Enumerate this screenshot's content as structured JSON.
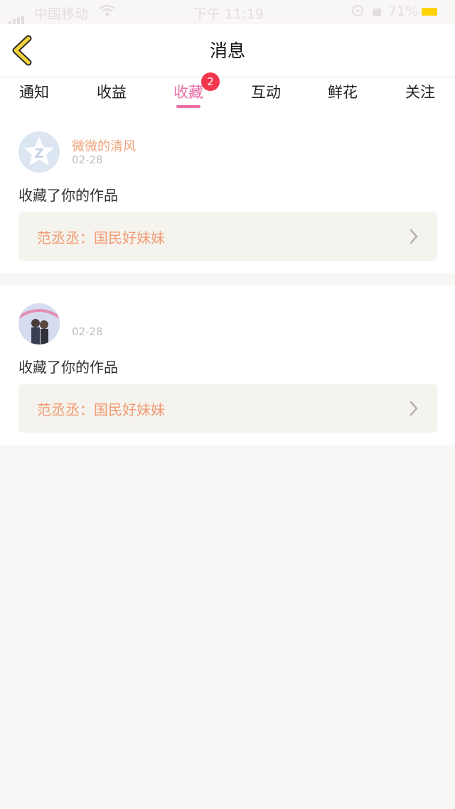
{
  "status_bar": {
    "carrier": "中国移动",
    "time": "下午 11:19",
    "battery": "71%"
  },
  "header": {
    "title": "消息",
    "back_icon": "chevron-left-icon"
  },
  "tabs": [
    {
      "label": "通知",
      "active": false
    },
    {
      "label": "收益",
      "active": false
    },
    {
      "label": "收藏",
      "active": true,
      "badge": "2"
    },
    {
      "label": "互动",
      "active": false
    },
    {
      "label": "鲜花",
      "active": false
    },
    {
      "label": "关注",
      "active": false
    }
  ],
  "messages": [
    {
      "username": "微微的清风",
      "date": "02-28",
      "action": "收藏了你的作品",
      "work_title": "范丞丞：国民好妹妹",
      "avatar_icon": "qq-star-avatar-icon"
    },
    {
      "username": "",
      "date": "02-28",
      "action": "收藏了你的作品",
      "work_title": "范丞丞：国民好妹妹",
      "avatar_icon": "photo-avatar-icon"
    }
  ],
  "colors": {
    "accent": "#e96ea7",
    "badge": "#f2364d",
    "username": "#f0a37b",
    "work_title": "#f29a72",
    "back_arrow": "#f2d33a"
  }
}
